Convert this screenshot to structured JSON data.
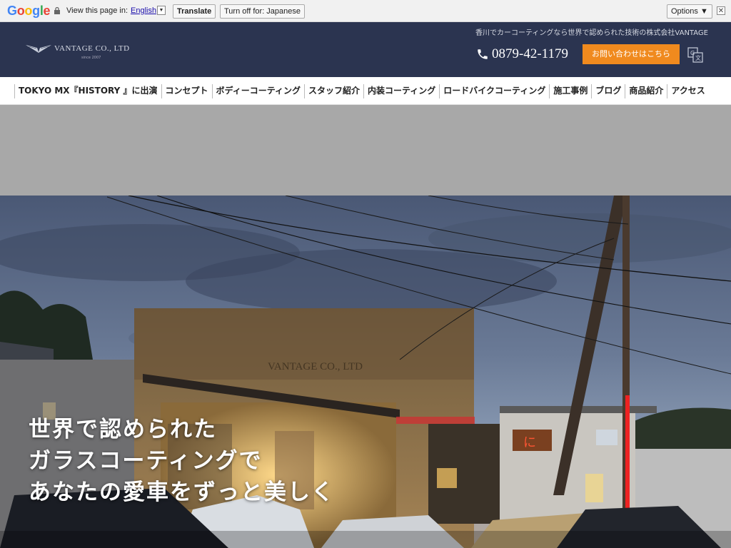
{
  "translate_bar": {
    "logo": "Google",
    "view_text": "View this page in:",
    "language": "English",
    "translate_btn": "Translate",
    "turnoff_btn": "Turn off for: Japanese",
    "options_btn": "Options ▼",
    "close": "✕"
  },
  "header": {
    "tagline": "香川でカーコーティングなら世界で認められた技術の株式会社VANTAGE",
    "logo_text": "VANTAGE CO., LTD",
    "logo_sub": "since 2007",
    "phone": "0879-42-1179",
    "contact_btn": "お問い合わせはこちら"
  },
  "nav": {
    "items": [
      "TOKYO MX『HISTORY 』に出演",
      "コンセプト",
      "ボディーコーティング",
      "スタッフ紹介",
      "内装コーティング",
      "ロードバイクコーティング",
      "施工事例",
      "ブログ",
      "商品紹介",
      "アクセス"
    ]
  },
  "hero": {
    "line1": "世界で認められた",
    "line2": "ガラスコーティングで",
    "line3": "あなたの愛車をずっと美しく",
    "building_sign": "VANTAGE CO., LTD"
  },
  "colors": {
    "header_bg": "#2b3450",
    "accent": "#f08a1e"
  }
}
